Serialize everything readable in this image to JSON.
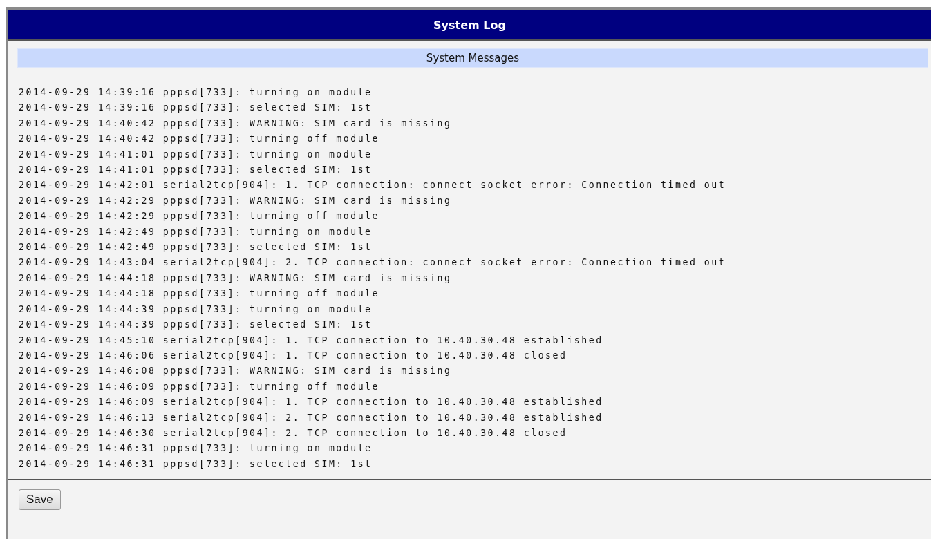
{
  "window": {
    "title": "System Log"
  },
  "section": {
    "title": "System Messages"
  },
  "log_lines": [
    "2014-09-29 14:39:16 pppsd[733]: turning on module",
    "2014-09-29 14:39:16 pppsd[733]: selected SIM: 1st",
    "2014-09-29 14:40:42 pppsd[733]: WARNING: SIM card is missing",
    "2014-09-29 14:40:42 pppsd[733]: turning off module",
    "2014-09-29 14:41:01 pppsd[733]: turning on module",
    "2014-09-29 14:41:01 pppsd[733]: selected SIM: 1st",
    "2014-09-29 14:42:01 serial2tcp[904]: 1. TCP connection: connect socket error: Connection timed out",
    "2014-09-29 14:42:29 pppsd[733]: WARNING: SIM card is missing",
    "2014-09-29 14:42:29 pppsd[733]: turning off module",
    "2014-09-29 14:42:49 pppsd[733]: turning on module",
    "2014-09-29 14:42:49 pppsd[733]: selected SIM: 1st",
    "2014-09-29 14:43:04 serial2tcp[904]: 2. TCP connection: connect socket error: Connection timed out",
    "2014-09-29 14:44:18 pppsd[733]: WARNING: SIM card is missing",
    "2014-09-29 14:44:18 pppsd[733]: turning off module",
    "2014-09-29 14:44:39 pppsd[733]: turning on module",
    "2014-09-29 14:44:39 pppsd[733]: selected SIM: 1st",
    "2014-09-29 14:45:10 serial2tcp[904]: 1. TCP connection to 10.40.30.48 established",
    "2014-09-29 14:46:06 serial2tcp[904]: 1. TCP connection to 10.40.30.48 closed",
    "2014-09-29 14:46:08 pppsd[733]: WARNING: SIM card is missing",
    "2014-09-29 14:46:09 pppsd[733]: turning off module",
    "2014-09-29 14:46:09 serial2tcp[904]: 1. TCP connection to 10.40.30.48 established",
    "2014-09-29 14:46:13 serial2tcp[904]: 2. TCP connection to 10.40.30.48 established",
    "2014-09-29 14:46:30 serial2tcp[904]: 2. TCP connection to 10.40.30.48 closed",
    "2014-09-29 14:46:31 pppsd[733]: turning on module",
    "2014-09-29 14:46:31 pppsd[733]: selected SIM: 1st"
  ],
  "buttons": [
    "Save"
  ]
}
